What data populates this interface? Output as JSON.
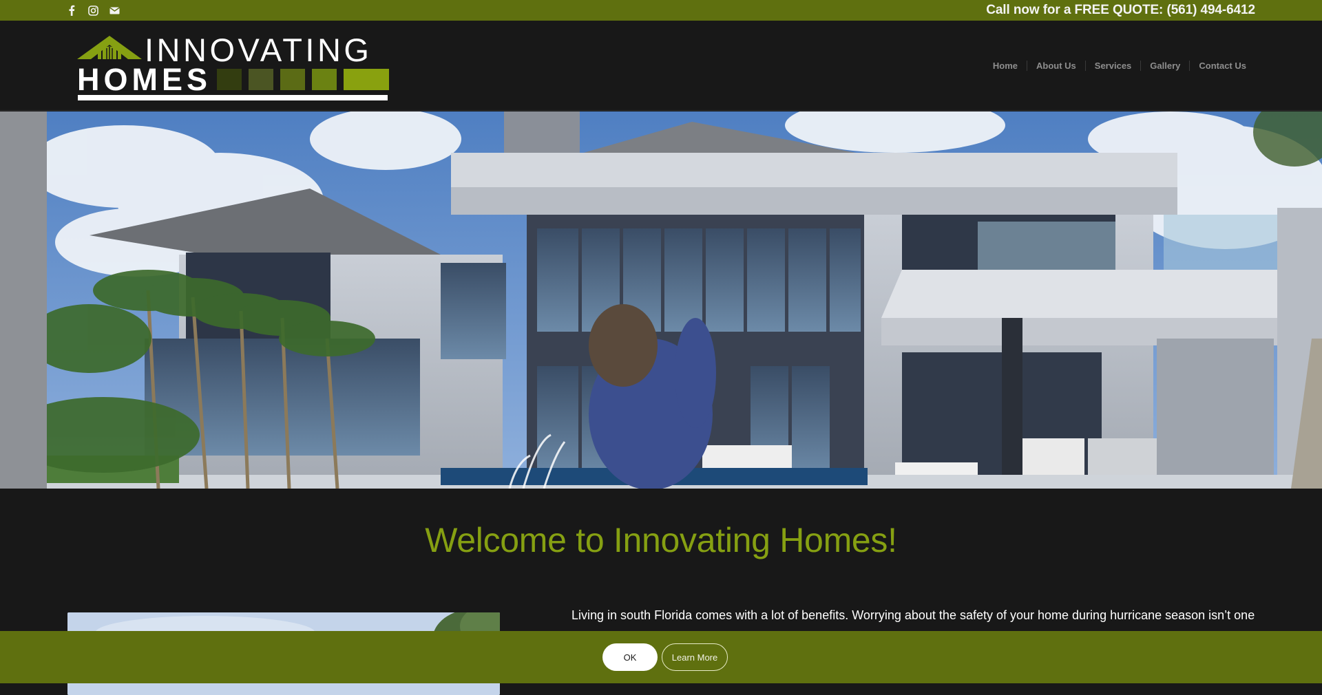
{
  "topbar": {
    "social_icons": [
      {
        "name": "facebook-icon",
        "glyph": "f"
      },
      {
        "name": "instagram-icon",
        "glyph": "instagram"
      },
      {
        "name": "email-icon",
        "glyph": "envelope"
      }
    ],
    "phone_cta": "Call now for a FREE QUOTE: (561) 494-6412"
  },
  "header": {
    "logo": {
      "line1": "INNOVATING",
      "line2": "HOMES",
      "swatches": [
        "#333d10",
        "#4b5523",
        "#5b6b15",
        "#6b8212",
        "#89a10f"
      ],
      "accent": "#86a012"
    },
    "nav": [
      {
        "label": "Home"
      },
      {
        "label": "About Us"
      },
      {
        "label": "Services"
      },
      {
        "label": "Gallery"
      },
      {
        "label": "Contact Us"
      }
    ]
  },
  "hero": {
    "alt": "Modern luxury home with pool, palm trees and sculpture"
  },
  "main": {
    "heading": "Welcome to Innovating Homes!",
    "intro": "Living in south Florida comes with a lot of benefits. Worrying about the safety of your home during hurricane season isn’t one"
  },
  "cookie_bar": {
    "ok_label": "OK",
    "learn_more_label": "Learn More"
  },
  "colors": {
    "brand_green": "#5f700f",
    "heading_green": "#86a012",
    "background": "#181818",
    "nav_text": "#8e8e8e"
  }
}
